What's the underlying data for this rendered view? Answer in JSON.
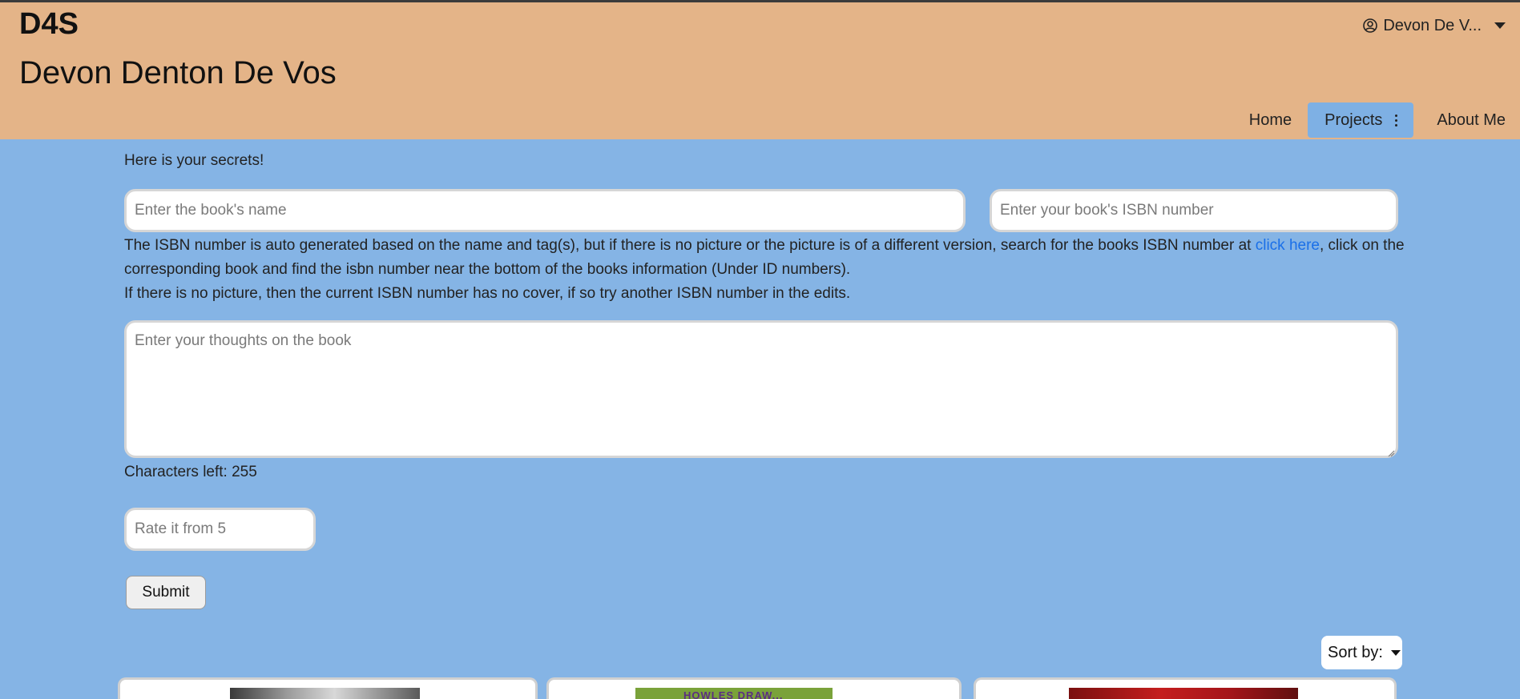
{
  "header": {
    "brand": "D4S",
    "site_title": "Devon Denton De Vos",
    "user_menu_label": "Devon De V...",
    "nav": {
      "home": "Home",
      "projects": "Projects",
      "about": "About Me"
    }
  },
  "main": {
    "secret_line": "Here is your secrets!",
    "book_name_placeholder": "Enter the book's name",
    "isbn_placeholder": "Enter your book's ISBN number",
    "info_part1": "The ISBN number is auto generated based on the name and tag(s), but if there is no picture or the picture is of a different version, search for the books ISBN number at ",
    "info_link": "click here",
    "info_part2": ", click on the corresponding book and find the isbn number near the bottom of the books information (Under ID numbers).",
    "info_line2": "If there is no picture, then the current ISBN number has no cover, if so try another ISBN number in the edits.",
    "thoughts_placeholder": "Enter your thoughts on the book",
    "chars_left": "Characters left: 255",
    "rating_placeholder": "Rate it from 5",
    "submit_label": "Submit",
    "sort_label": "Sort by:"
  },
  "cards": [
    {
      "cover_text": ""
    },
    {
      "cover_text": "HOWLES DRAW..."
    },
    {
      "cover_text": ""
    }
  ],
  "icons": {
    "user": "user-circle-icon",
    "user_caret": "caret-down-icon",
    "projects_more": "kebab-icon",
    "sort_caret": "caret-down-icon"
  },
  "colors": {
    "header_bg": "#e4b488",
    "page_bg": "#85b4e5",
    "active_nav_bg": "#7eb0e4",
    "link": "#1a6fe8"
  }
}
